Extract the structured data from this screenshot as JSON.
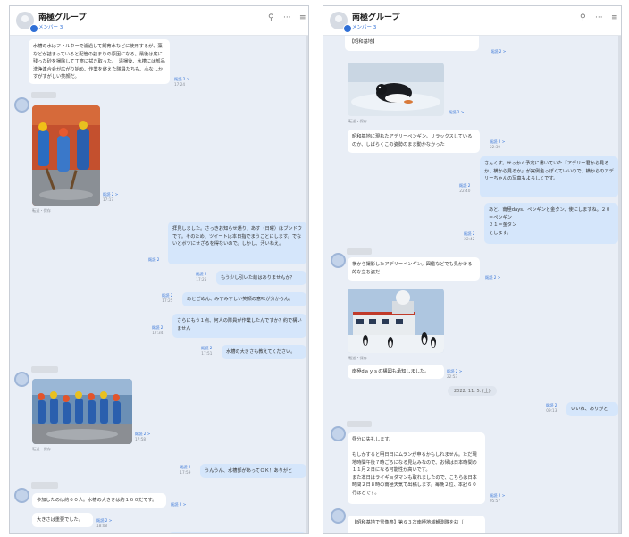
{
  "left": {
    "header": {
      "title": "南極グループ",
      "subtitle": "メンバー 3",
      "search_icon": "search-icon",
      "more_icon": "more-icon",
      "menu_icon": "menu-icon"
    },
    "msg_top": {
      "text": "水槽の水はフィルターで濾過して飼育水などに使用するが、藻などが詰まっていると配管の詰まりの原因になる。最後は底に残った砂を掃除して丁寧に拭き取った。　清掃後、水槽には部品洗浄連合会が広がり始め、作業を終えた隊員たちも、心なしかすがすがしい笑顔だ。",
      "meta_read": "既読 2 >",
      "meta_time": "17:24"
    },
    "photo1": {
      "meta_read": "既読 2 >",
      "meta_time": "17:17",
      "caption": "転送・保存"
    },
    "msg_out1": {
      "text": "拝見しました。さっきお知らせ通り、あす（日曜）はブンドウです。そのため、ツイートは本日指でまうことにします。でないとボツにせざるを得ないので。しかし、汚いねえ。",
      "meta_read": "既読 2",
      "meta_time": "17:25"
    },
    "msg_out2": {
      "text": "もう少し引いた絵はありませんか？",
      "meta_read": "既読 2",
      "meta_time": "17:25"
    },
    "msg_out3": {
      "text": "あとごめん、みすみすしい笑顔の意味が分からん。",
      "meta_read": "既読 2",
      "meta_time": "17:25"
    },
    "msg_out4": {
      "text": "さらにもう１点、何人の隊員が作業したんですか？約で構いません",
      "meta_read": "既読 2",
      "meta_time": "17:34"
    },
    "msg_out5": {
      "text": "水槽の大きさも教えてください。",
      "meta_read": "既読 2",
      "meta_time": "17:51"
    },
    "photo2": {
      "meta_read": "既読 2 >",
      "meta_time": "17:58",
      "caption": "転送・保存"
    },
    "msg_out6": {
      "text": "うんうん、水槽部があってＯＫ！ありがと",
      "meta_read": "既読 2",
      "meta_time": "17:59"
    },
    "msg_in1": {
      "text": "参加したのは約６０人。水槽の大きさは約１６０だです。",
      "meta_read": "既読 2 >",
      "meta_time": ""
    },
    "msg_in2": {
      "text": "大きさは重要でした。",
      "meta_read": "既読 2 >",
      "meta_time": "18:08"
    }
  },
  "right": {
    "header": {
      "title": "南極グループ",
      "subtitle": "メンバー 3",
      "search_icon": "search-icon",
      "more_icon": "more-icon",
      "menu_icon": "menu-icon"
    },
    "msg_top": {
      "text": "【昭和基地】",
      "meta_read": "既読 2 >",
      "meta_time": ""
    },
    "photo1": {
      "caption": "転送・保存",
      "meta_read": "既読 2 >",
      "meta_time": ""
    },
    "msg_in1": {
      "text": "昭和基地に現れたアデリーペンギン。リラックスしているのか、しばらくこの姿勢のまま動かなかった",
      "meta_read": "既読 2 >",
      "meta_time": "22:39"
    },
    "msg_out1": {
      "text": "さんくす。せっかく予定に書いていた「アデリー君から見るか、横から見るか」が実例金っぽくていいので、横からのアデリーちゃんの写真もよろしくです。",
      "meta_read": "既読 2",
      "meta_time": "22:40"
    },
    "msg_out2": {
      "text": "あと、南極days、ペンギンと金タン、使にしますね。２０＝ペンギン\n２１＝金タン\nとします。",
      "meta_read": "既読 2",
      "meta_time": "22:42"
    },
    "msg_in2": {
      "text": "横から撮影したアデリーペンギン。図鑑などでも見かける的な立ち姿だ",
      "meta_read": "既読 2 >",
      "meta_time": ""
    },
    "photo2": {
      "caption": "転送・保存",
      "meta_read": "",
      "meta_time": ""
    },
    "msg_in3": {
      "text": "南極dａｙｓの構図も承知しました。",
      "meta_read": "既読 2 >",
      "meta_time": "22:53"
    },
    "date": "2022. 11. 5. (土)",
    "msg_out3": {
      "text": "いいね、ありがと",
      "meta_read": "既読 2",
      "meta_time": "09:13"
    },
    "msg_in4": {
      "text": "昼分に失礼します。\n\nもしかすると明日日にムランが申るかもしれません。ただ現地時間午後７時ごろになる見込みなので、お帰は日本時間の１１月２日になる可能性が高いです。\nまた本日はライギョダマンも取れましたので、こちらは日本時間２日８時の南極天気で出稿します。毎晩２位、本記６０行ほどです。",
      "meta_read": "既読 2 >",
      "meta_time": "05:57"
    },
    "msg_in5": {
      "text": "【昭和基地で雪像祭】第６３次南極地域観測隊を訪（",
      "meta_read": "",
      "meta_time": ""
    }
  }
}
